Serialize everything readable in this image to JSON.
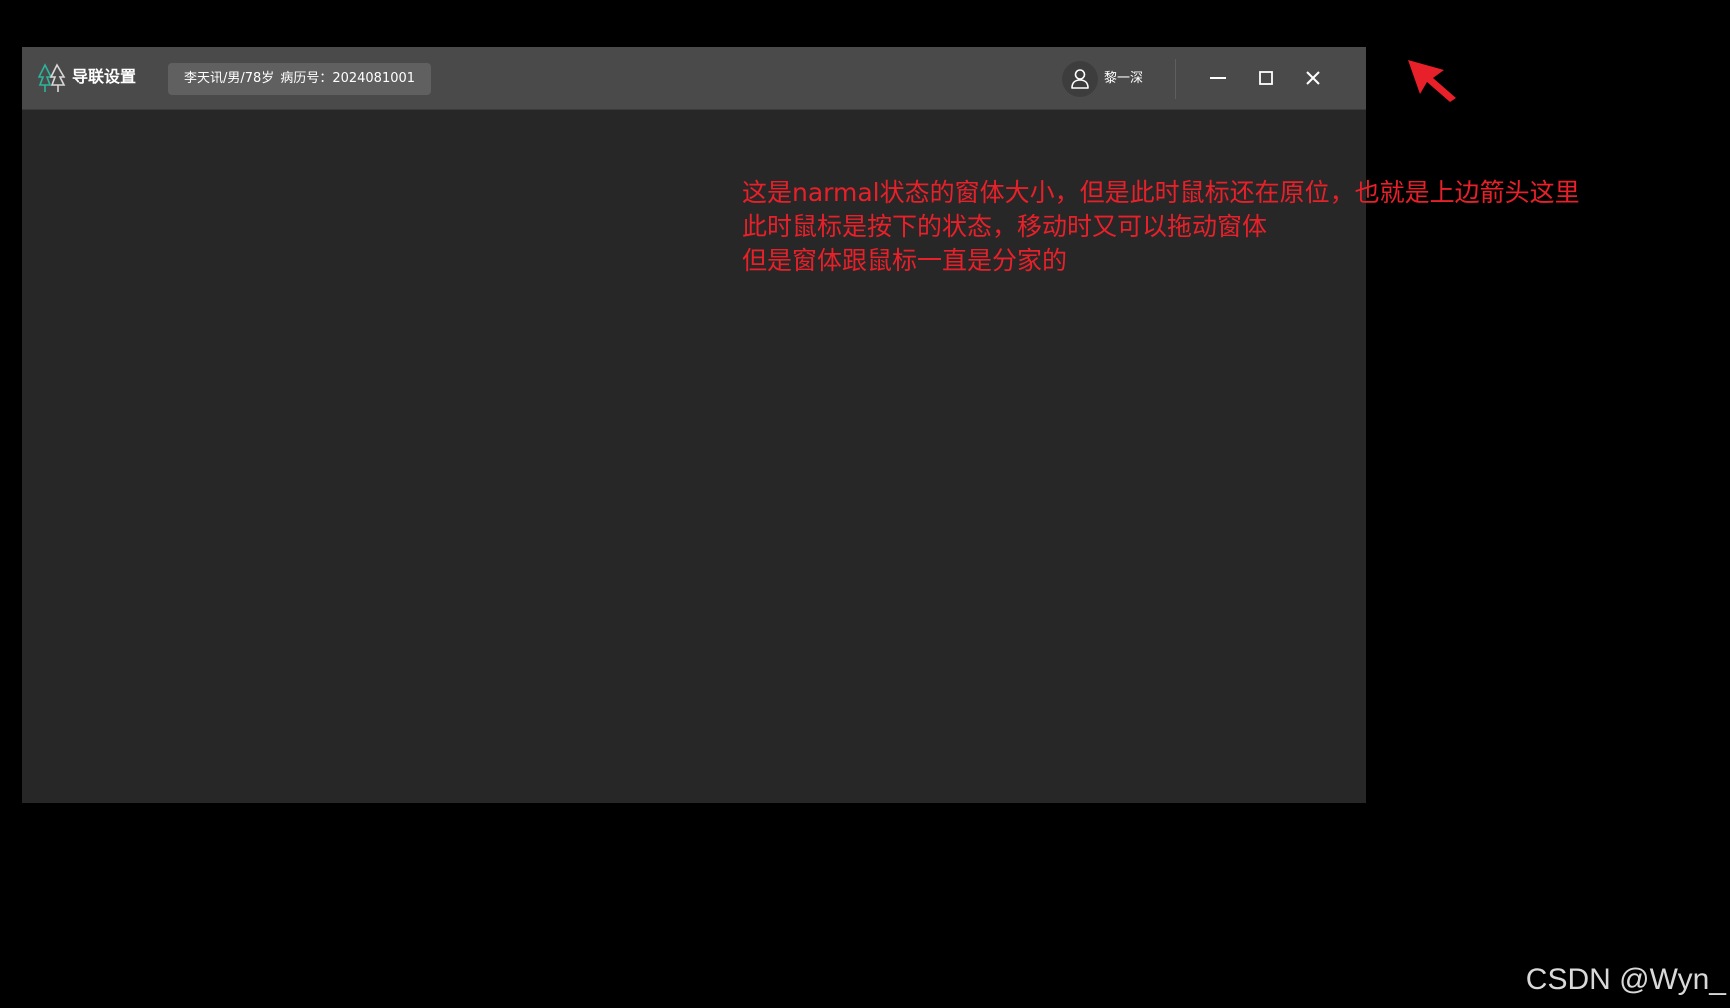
{
  "window": {
    "title": "导联设置",
    "patient": {
      "info": "李天讯/男/78岁",
      "record": "病历号：2024081001"
    },
    "user": {
      "name": "黎一深"
    },
    "icons": {
      "logo": "app-logo-icon",
      "user": "user-icon",
      "minimize": "minimize-icon",
      "maximize": "maximize-icon",
      "close": "close-icon"
    }
  },
  "annotation": {
    "lines": [
      "这是narmal状态的窗体大小，但是此时鼠标还在原位，也就是上边箭头这里",
      "此时鼠标是按下的状态，移动时又可以拖动窗体",
      "但是窗体跟鼠标一直是分家的"
    ],
    "color": "#e8202a"
  },
  "watermark": "CSDN @Wyn_",
  "colors": {
    "desktop": "#000000",
    "titlebar": "#4a4a4a",
    "window_body": "#272727",
    "badge": "#606060"
  }
}
